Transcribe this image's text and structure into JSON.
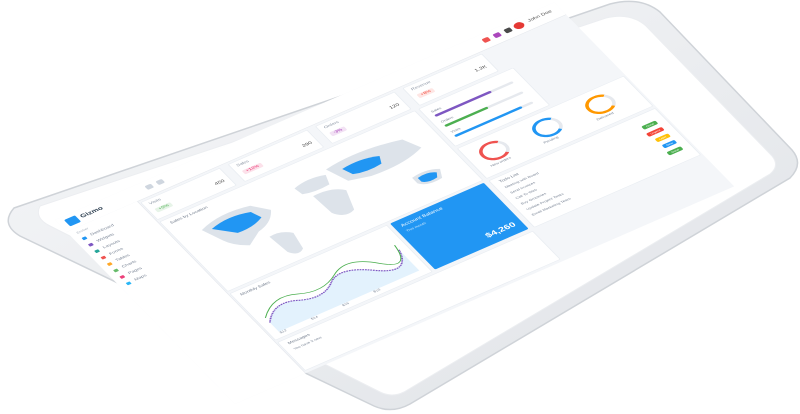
{
  "app": {
    "name": "Gizmo"
  },
  "topbar": {
    "user": "John Doe"
  },
  "sidebar": {
    "section_label": "Ember",
    "items": [
      {
        "label": "Dashboard",
        "color": "#2196f3"
      },
      {
        "label": "Widgets",
        "color": "#7e57c2"
      },
      {
        "label": "Layouts",
        "color": "#26a69a"
      },
      {
        "label": "Forms",
        "color": "#ef5350"
      },
      {
        "label": "Tables",
        "color": "#ffa726"
      },
      {
        "label": "Charts",
        "color": "#66bb6a"
      },
      {
        "label": "Pages",
        "color": "#ec407a"
      },
      {
        "label": "Maps",
        "color": "#29b6f6"
      }
    ]
  },
  "stats": [
    {
      "title": "Visits",
      "badge": "+5%",
      "value": "450",
      "badge_color": "#4caf50"
    },
    {
      "title": "Sales",
      "badge": "+12%",
      "value": "290",
      "badge_color": "#e91e63"
    },
    {
      "title": "Orders",
      "badge": "-3%",
      "value": "120",
      "badge_color": "#9c27b0"
    },
    {
      "title": "Revenue",
      "badge": "+8%",
      "value": "1.2K",
      "badge_color": "#f44336"
    }
  ],
  "map_card": {
    "title": "Sales by Location"
  },
  "progress_card": {
    "items": [
      {
        "label": "Sales",
        "value": 0.72,
        "color": "#7e57c2"
      },
      {
        "label": "Orders",
        "value": 0.55,
        "color": "#4caf50"
      },
      {
        "label": "Visits",
        "value": 0.86,
        "color": "#2196f3"
      }
    ]
  },
  "donuts": [
    {
      "label": "New orders",
      "color": "#ef5350"
    },
    {
      "label": "Pending",
      "color": "#2196f3"
    },
    {
      "label": "Delivered",
      "color": "#ff9800"
    }
  ],
  "line_card": {
    "title": "Monthly Sales",
    "tabs": [
      "$12",
      "$14",
      "$16",
      "$18"
    ]
  },
  "blue_card": {
    "title": "Account Balance",
    "subtitle": "This month",
    "amount": "$4,260"
  },
  "todo_card": {
    "title": "Todo List",
    "items": [
      "Meeting with Board",
      "Send Invoices",
      "Call To Web",
      "Buy Groceries",
      "Update Project Tasks",
      "Email Marketing Team"
    ],
    "tags": [
      {
        "label": "Done",
        "color": "#4caf50"
      },
      {
        "label": "Urgent",
        "color": "#f44336"
      },
      {
        "label": "Later",
        "color": "#ffc107"
      },
      {
        "label": "New",
        "color": "#2196f3"
      },
      {
        "label": "Done",
        "color": "#4caf50"
      }
    ]
  },
  "footer_card": {
    "title": "Messages",
    "subtitle": "You have 3 new"
  }
}
